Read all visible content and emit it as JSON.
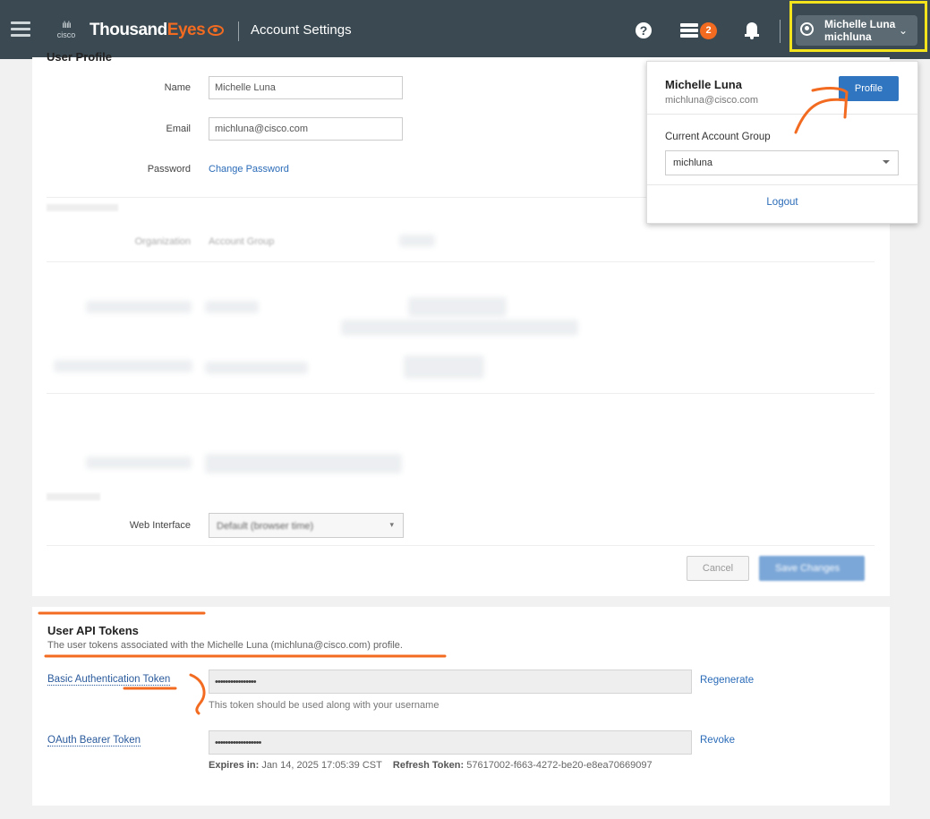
{
  "header": {
    "brand_cisco": "cisco",
    "brand_thousand": "Thousand",
    "brand_eyes": "Eyes",
    "page_name": "Account Settings",
    "help_glyph": "?",
    "notification_count": "2",
    "user_display_name": "Michelle Luna",
    "user_login": "michluna",
    "icons": [
      "menu-icon",
      "help-icon",
      "server-icon",
      "bell-icon",
      "user-avatar-icon",
      "chevron-down-icon"
    ]
  },
  "profile": {
    "title": "User Profile",
    "name_label": "Name",
    "name_value": "Michelle Luna",
    "email_label": "Email",
    "email_value": "michluna@cisco.com",
    "password_label": "Password",
    "change_password_link": "Change Password",
    "org_label": "Organization",
    "org_value": "Account Group",
    "web_interface_label": "Web Interface",
    "web_interface_value": "Default (browser time)",
    "cancel_label": "Cancel",
    "save_label": "Save Changes"
  },
  "tokens": {
    "title": "User API Tokens",
    "description": "The user tokens associated with the Michelle Luna (michluna@cisco.com) profile.",
    "basic_label": "Basic Authentication Token",
    "basic_value": "••••••••••••••••",
    "basic_action": "Regenerate",
    "basic_help": "This token should be used along with your username",
    "oauth_label": "OAuth Bearer Token",
    "oauth_value": "••••••••••••••••••",
    "oauth_action": "Revoke",
    "expires_label": "Expires in:",
    "expires_value": "Jan 14, 2025 17:05:39 CST",
    "refresh_label": "Refresh Token:",
    "refresh_value": "57617002-f663-4272-be20-e8ea70669097"
  },
  "user_menu": {
    "name": "Michelle Luna",
    "email": "michluna@cisco.com",
    "profile_button": "Profile",
    "group_label": "Current Account Group",
    "group_value": "michluna",
    "logout": "Logout"
  },
  "colors": {
    "topbar": "#3b4a52",
    "accent_orange": "#f26b21",
    "highlight_yellow": "#f2e31c",
    "primary_blue": "#2f75c0"
  }
}
